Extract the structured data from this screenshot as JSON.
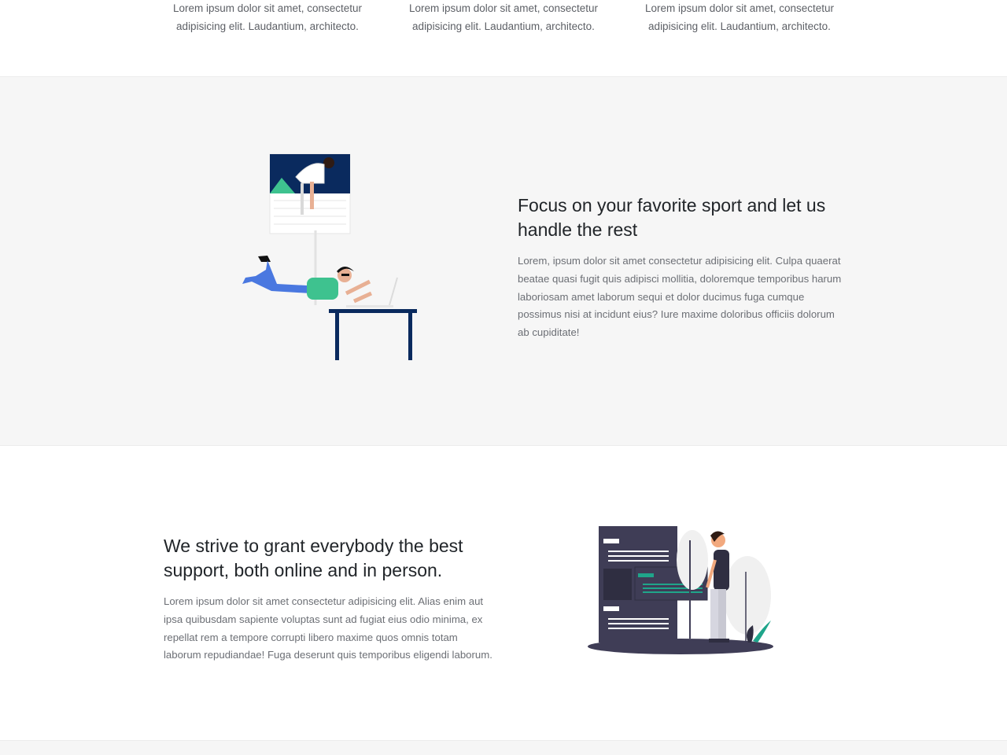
{
  "features": [
    {
      "text": "Lorem ipsum dolor sit amet, consectetur adipisicing elit. Laudantium, architecto."
    },
    {
      "text": "Lorem ipsum dolor sit amet, consectetur adipisicing elit. Laudantium, architecto."
    },
    {
      "text": "Lorem ipsum dolor sit amet, consectetur adipisicing elit. Laudantium, architecto."
    }
  ],
  "showcase_sport": {
    "heading": "Focus on your favorite sport and let us handle the rest",
    "body": "Lorem, ipsum dolor sit amet consectetur adipisicing elit. Culpa quaerat beatae quasi fugit quis adipisci mollitia, doloremque temporibus harum laboriosam amet laborum sequi et dolor ducimus fuga cumque possimus nisi at incidunt eius? Iure maxime doloribus officiis dolorum ab cupiditate!"
  },
  "showcase_support": {
    "heading": "We strive to grant everybody the best support, both online and in person.",
    "body": "Lorem ipsum dolor sit amet consectetur adipisicing elit. Alias enim aut ipsa quibusdam sapiente voluptas sunt ad fugiat eius odio minima, ex repellat rem a tempore corrupti libero maxime quos omnis totam laborum repudiandae! Fuga deserunt quis temporibus eligendi laborum."
  },
  "colors": {
    "navy": "#0a2a5e",
    "teal": "#3ec28f",
    "dark_panel": "#3f3d56",
    "accent_green": "#1fa58a",
    "section_gray": "#f6f6f6"
  }
}
